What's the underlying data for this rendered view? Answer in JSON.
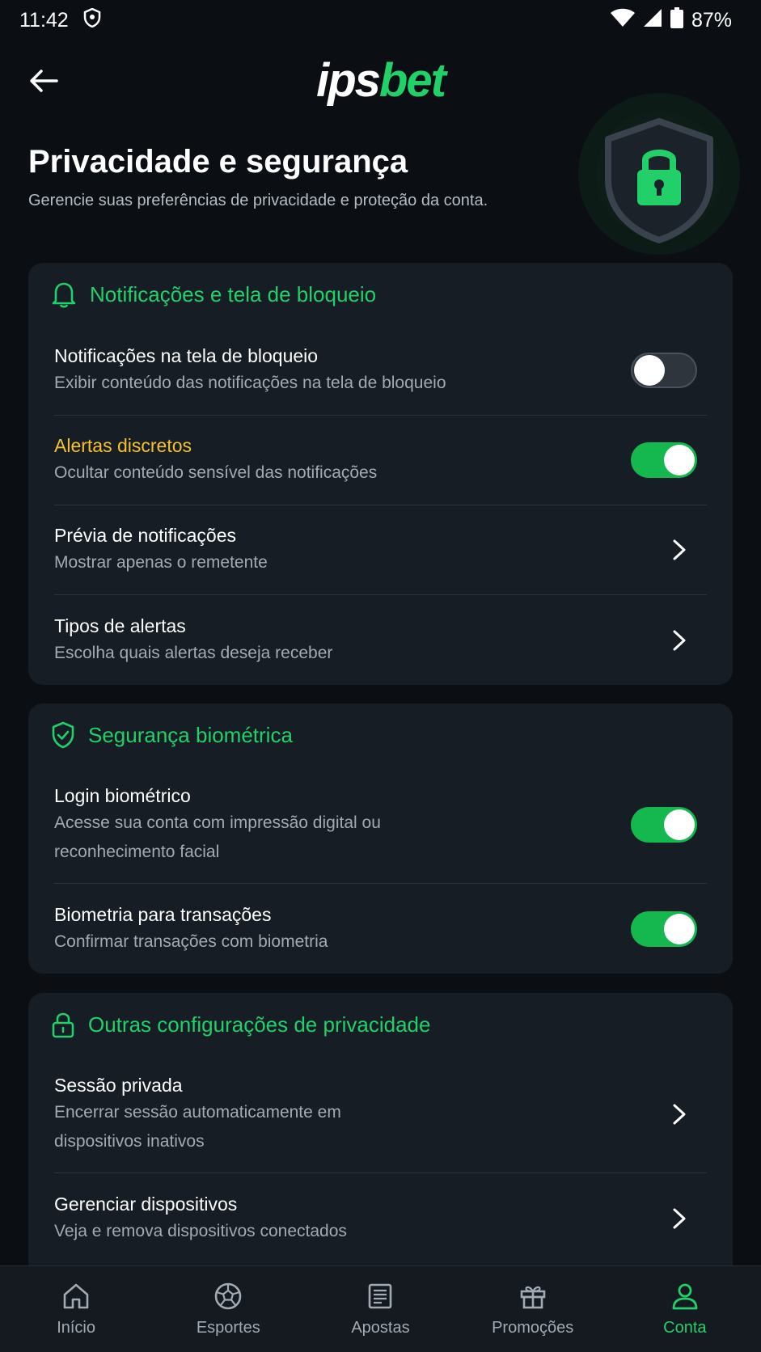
{
  "statusbar": {
    "time": "11:42",
    "battery": "87%"
  },
  "header": {
    "logo_part1": "ips",
    "logo_part2": "bet"
  },
  "page": {
    "title": "Privacidade e segurança",
    "subtitle": "Gerencie suas preferências de privacidade e proteção da conta."
  },
  "sections": [
    {
      "title": "Notificações e tela de bloqueio",
      "items": [
        {
          "title": "Notificações na tela de bloqueio",
          "desc": "Exibir conteúdo das notificações na tela de bloqueio",
          "control": "toggle",
          "on": false
        },
        {
          "title": "Alertas discretos",
          "desc": "Ocultar conteúdo sensível das notificações",
          "control": "toggle",
          "on": true
        },
        {
          "title": "Prévia de notificações",
          "desc": "Mostrar apenas o remetente",
          "control": "chevron"
        },
        {
          "title": "Tipos de alertas",
          "desc": "Escolha quais alertas deseja receber",
          "control": "chevron"
        }
      ]
    },
    {
      "title": "Segurança biométrica",
      "items": [
        {
          "title": "Login biométrico",
          "desc_line1": "Acesse sua conta com impressão digital ou",
          "desc_line2": "reconhecimento facial",
          "control": "toggle",
          "on": true
        },
        {
          "title": "Biometria para transações",
          "desc": "Confirmar transações com biometria",
          "control": "toggle",
          "on": true
        }
      ]
    },
    {
      "title": "Outras configurações de privacidade",
      "items": [
        {
          "title": "Sessão privada",
          "desc_line1": "Encerrar sessão automaticamente em",
          "desc_line2": "dispositivos inativos",
          "control": "chevron"
        },
        {
          "title": "Gerenciar dispositivos",
          "desc": "Veja e remova dispositivos conectados",
          "control": "chevron"
        }
      ]
    }
  ],
  "nav": [
    {
      "label": "Início",
      "icon": "home-icon"
    },
    {
      "label": "Esportes",
      "icon": "soccer-ball-icon"
    },
    {
      "label": "Apostas",
      "icon": "bet-slip-icon"
    },
    {
      "label": "Promoções",
      "icon": "gift-icon"
    },
    {
      "label": "Conta",
      "icon": "user-icon",
      "active": true
    }
  ],
  "colors": {
    "accent": "#22d06a",
    "warning": "#f4c12b",
    "background": "#0b0f13",
    "card": "#171d24"
  }
}
